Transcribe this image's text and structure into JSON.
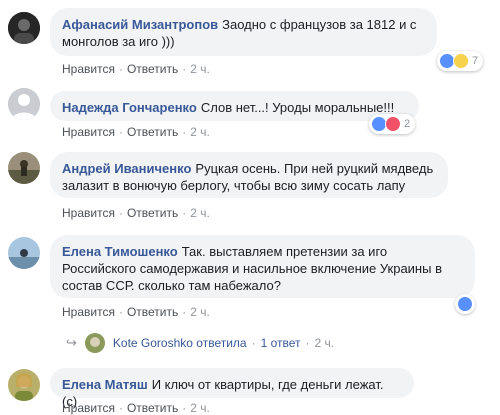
{
  "comments": [
    {
      "author": "Афанасий Мизантропов",
      "text_line1": "Заодно с французов за 1812 и с",
      "text_line2": "монголов за иго )))",
      "like": "Нравится",
      "reply": "Ответить",
      "time": "2 ч.",
      "reaction_count": "7",
      "reaction_icons": [
        "like-icon",
        "haha-icon"
      ]
    },
    {
      "author": "Надежда Гончаренко",
      "text_line1": "Слов нет...! Уроды моральные!!!",
      "like": "Нравится",
      "reply": "Ответить",
      "time": "2 ч.",
      "reaction_count": "2",
      "reaction_icons": [
        "like-icon",
        "love-icon"
      ]
    },
    {
      "author": "Андрей Иваниченко",
      "text_line1": "Руцкая осень. При ней руцкий мядведь",
      "text_line2": "залазит в вонючую берлогу, чтобы всю зиму сосать лапу",
      "like": "Нравится",
      "reply": "Ответить",
      "time": "2 ч."
    },
    {
      "author": "Елена Тимошенко",
      "text_line1": "Так. выставляем претензии за иго",
      "text_line2": "Российского самодержавия и насильное включение Украины в",
      "text_line3": "состав ССР. сколько там набежало?",
      "like": "Нравится",
      "reply": "Ответить",
      "time": "2 ч.",
      "reaction_icons": [
        "like-icon"
      ]
    },
    {
      "author": "Елена Матяш",
      "text_line1": "И ключ от квартиры, где деньги лежат. (с)",
      "like": "Нравится",
      "reply": "Ответить",
      "time": "2 ч."
    }
  ],
  "reply_summary": {
    "replier": "Kote Goroshko",
    "verb": "ответила",
    "sep": "·",
    "count": "1 ответ",
    "time": "2 ч."
  },
  "colors": {
    "name_link": "#385898",
    "bubble": "#f2f3f5",
    "like_blue": "#5890ff",
    "love_red": "#f25268",
    "haha_yellow": "#f7d24d"
  }
}
